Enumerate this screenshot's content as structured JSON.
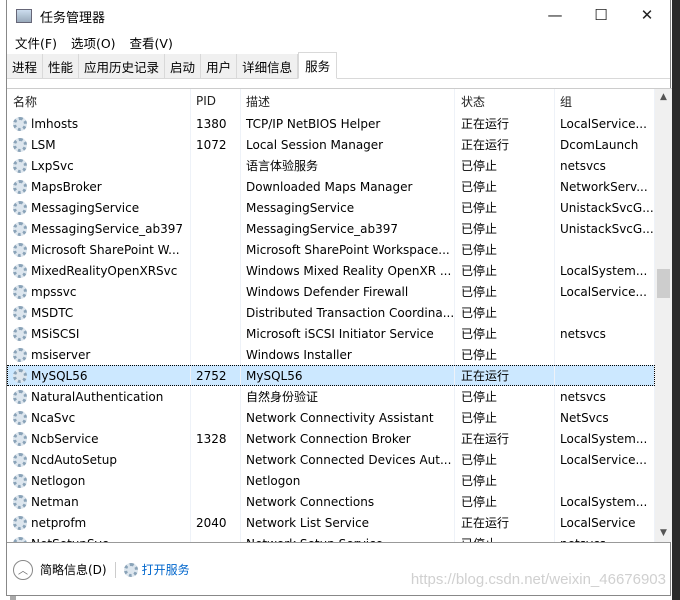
{
  "window": {
    "title": "任务管理器",
    "minimize": "—",
    "maximize": "☐",
    "close": "✕"
  },
  "menu": [
    "文件(F)",
    "选项(O)",
    "查看(V)"
  ],
  "tabs": [
    "进程",
    "性能",
    "应用历史记录",
    "启动",
    "用户",
    "详细信息",
    "服务"
  ],
  "active_tab": "服务",
  "columns": [
    "名称",
    "PID",
    "描述",
    "状态",
    "组"
  ],
  "rows": [
    [
      "lmhosts",
      "1380",
      "TCP/IP NetBIOS Helper",
      "正在运行",
      "LocalService..."
    ],
    [
      "LSM",
      "1072",
      "Local Session Manager",
      "正在运行",
      "DcomLaunch"
    ],
    [
      "LxpSvc",
      "",
      "语言体验服务",
      "已停止",
      "netsvcs"
    ],
    [
      "MapsBroker",
      "",
      "Downloaded Maps Manager",
      "已停止",
      "NetworkServ..."
    ],
    [
      "MessagingService",
      "",
      "MessagingService",
      "已停止",
      "UnistackSvcG..."
    ],
    [
      "MessagingService_ab397",
      "",
      "MessagingService_ab397",
      "已停止",
      "UnistackSvcG..."
    ],
    [
      "Microsoft SharePoint W...",
      "",
      "Microsoft SharePoint Workspace...",
      "已停止",
      ""
    ],
    [
      "MixedRealityOpenXRSvc",
      "",
      "Windows Mixed Reality OpenXR ...",
      "已停止",
      "LocalSystem..."
    ],
    [
      "mpssvc",
      "",
      "Windows Defender Firewall",
      "已停止",
      "LocalService..."
    ],
    [
      "MSDTC",
      "",
      "Distributed Transaction Coordina...",
      "已停止",
      ""
    ],
    [
      "MSiSCSI",
      "",
      "Microsoft iSCSI Initiator Service",
      "已停止",
      "netsvcs"
    ],
    [
      "msiserver",
      "",
      "Windows Installer",
      "已停止",
      ""
    ],
    [
      "MySQL56",
      "2752",
      "MySQL56",
      "正在运行",
      ""
    ],
    [
      "NaturalAuthentication",
      "",
      "自然身份验证",
      "已停止",
      "netsvcs"
    ],
    [
      "NcaSvc",
      "",
      "Network Connectivity Assistant",
      "已停止",
      "NetSvcs"
    ],
    [
      "NcbService",
      "1328",
      "Network Connection Broker",
      "正在运行",
      "LocalSystem..."
    ],
    [
      "NcdAutoSetup",
      "",
      "Network Connected Devices Aut...",
      "已停止",
      "LocalService..."
    ],
    [
      "Netlogon",
      "",
      "Netlogon",
      "已停止",
      ""
    ],
    [
      "Netman",
      "",
      "Network Connections",
      "已停止",
      "LocalSystem..."
    ],
    [
      "netprofm",
      "2040",
      "Network List Service",
      "正在运行",
      "LocalService"
    ],
    [
      "NetSetupSvc",
      "",
      "Network Setup Service",
      "已停止",
      "netsvcs"
    ]
  ],
  "selected_row": "MySQL56",
  "footer": {
    "brief": "简略信息(D)",
    "open_services": "打开服务"
  },
  "watermark": "https://blog.csdn.net/weixin_46676903",
  "colors": {
    "selection": "#cce8ff",
    "link": "#0066cc"
  }
}
